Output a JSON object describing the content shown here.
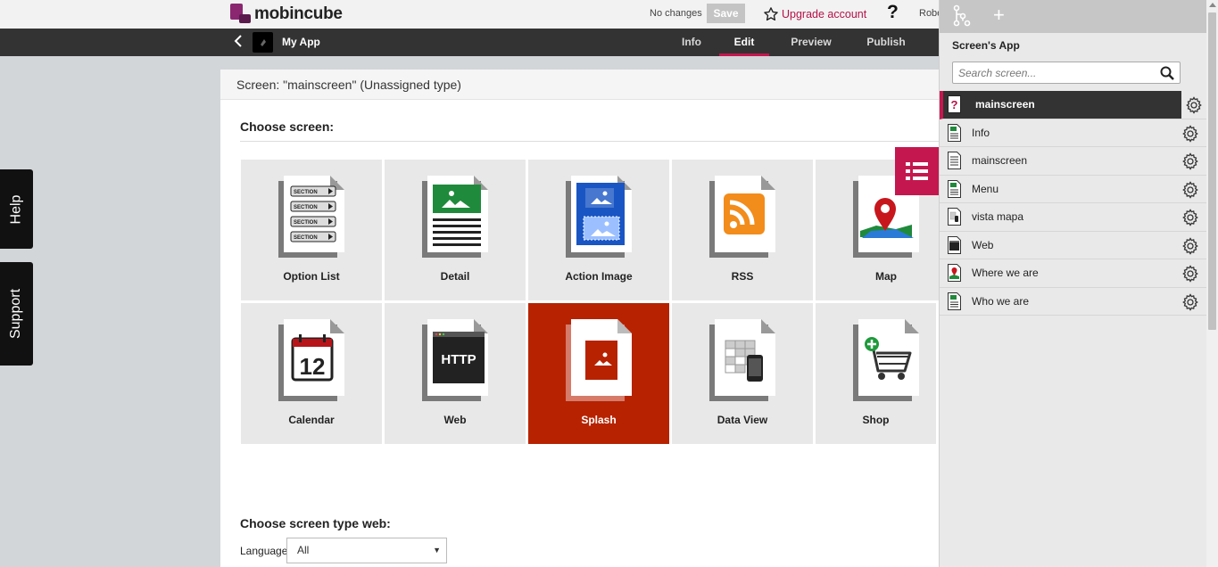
{
  "topbar": {
    "logo_text": "mobincube",
    "status": "No changes",
    "save_label": "Save",
    "upgrade_label": "Upgrade account",
    "help_label": "?",
    "user": "Robe"
  },
  "nav": {
    "app_name": "My App",
    "tabs": [
      {
        "label": "Info"
      },
      {
        "label": "Edit"
      },
      {
        "label": "Preview"
      },
      {
        "label": "Publish"
      }
    ],
    "active_tab": "Edit"
  },
  "side_tabs": {
    "help": "Help",
    "support": "Support"
  },
  "content": {
    "screen_header": "Screen: \"mainscreen\" (Unassigned type)",
    "choose_title": "Choose screen:",
    "tiles": [
      {
        "label": "Option List",
        "icon": "option-list-icon"
      },
      {
        "label": "Detail",
        "icon": "detail-icon"
      },
      {
        "label": "Action Image",
        "icon": "action-image-icon"
      },
      {
        "label": "RSS",
        "icon": "rss-icon"
      },
      {
        "label": "Map",
        "icon": "map-icon"
      },
      {
        "label": "Calendar",
        "icon": "calendar-icon"
      },
      {
        "label": "Web",
        "icon": "web-icon"
      },
      {
        "label": "Splash",
        "icon": "splash-icon"
      },
      {
        "label": "Data View",
        "icon": "data-view-icon"
      },
      {
        "label": "Shop",
        "icon": "shop-icon"
      }
    ],
    "selected_tile": "Splash",
    "option_list_sections": [
      "SECTION",
      "SECTION",
      "SECTION",
      "SECTION"
    ],
    "calendar_day": "12",
    "web_icon_text": "HTTP",
    "web_title": "Choose screen type web:",
    "language_label": "Language",
    "language_value": "All"
  },
  "panel": {
    "title": "Screen's App",
    "search_placeholder": "Search screen...",
    "screens": [
      {
        "label": "mainscreen",
        "active": true
      },
      {
        "label": "Info"
      },
      {
        "label": "mainscreen"
      },
      {
        "label": "Menu"
      },
      {
        "label": "vista mapa"
      },
      {
        "label": "Web"
      },
      {
        "label": "Where we are"
      },
      {
        "label": "Who we are"
      }
    ]
  },
  "colors": {
    "accent": "#c5174f",
    "selected_tile": "#b72201",
    "navbar": "#333333"
  }
}
